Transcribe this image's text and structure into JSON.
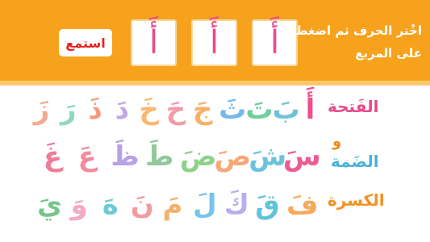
{
  "header": {
    "listen_label": "استمع",
    "instruction_line1": "اخْتر الحرف ثم اضغط",
    "instruction_line2": "على المربع",
    "answer_cards": [
      "أَ",
      "أَ",
      "أَ"
    ]
  },
  "labels": {
    "fatha": "الفَتحة",
    "waw": "و",
    "damma": "الضَمة",
    "kasra": "الكسرة"
  },
  "colors": {
    "header": "#f7a21c",
    "listen_text": "#e8221f",
    "fatha_label": "#e84a8a",
    "damma_label": "#49b3d4",
    "kasra_label": "#f29221"
  },
  "rows": [
    {
      "letters": [
        {
          "ch": "أَ",
          "color": "#ef4e8c"
        },
        {
          "ch": "بَ",
          "color": "#70c2d6"
        },
        {
          "ch": "تَ",
          "color": "#6ed09a"
        },
        {
          "ch": "ثَ",
          "color": "#76b8ec"
        },
        {
          "ch": "جَ",
          "color": "#f7b066"
        },
        {
          "ch": "حَ",
          "color": "#f29ca7"
        },
        {
          "ch": "خَ",
          "color": "#f9b872"
        },
        {
          "ch": "دَ",
          "color": "#c3a7e5"
        },
        {
          "ch": "ذَ",
          "color": "#f49a7d"
        },
        {
          "ch": "رَ",
          "color": "#8ed7c2"
        },
        {
          "ch": "زَ",
          "color": "#f6a98c"
        }
      ]
    },
    {
      "letters": [
        {
          "ch": "سَ",
          "color": "#ec5c94"
        },
        {
          "ch": "شَ",
          "color": "#6cc2dd"
        },
        {
          "ch": "صَ",
          "color": "#f7a877"
        },
        {
          "ch": "ضَ",
          "color": "#8fd18a"
        },
        {
          "ch": "طَ",
          "color": "#93c89c"
        },
        {
          "ch": "ظَ",
          "color": "#b6a2e5"
        },
        {
          "ch": "عَ",
          "color": "#f48a9a"
        },
        {
          "ch": "غَ",
          "color": "#f07b97"
        }
      ]
    },
    {
      "letters": [
        {
          "ch": "فَ",
          "color": "#f6a95c"
        },
        {
          "ch": "قَ",
          "color": "#5fc3da"
        },
        {
          "ch": "كَ",
          "color": "#b7b0eb"
        },
        {
          "ch": "لَ",
          "color": "#76c4ea"
        },
        {
          "ch": "مَ",
          "color": "#f3b26c"
        },
        {
          "ch": "نَ",
          "color": "#f29aa1"
        },
        {
          "ch": "هَ",
          "color": "#70c9d7"
        },
        {
          "ch": "وَ",
          "color": "#f5a9c3"
        },
        {
          "ch": "يَ",
          "color": "#77c48c"
        }
      ]
    }
  ]
}
